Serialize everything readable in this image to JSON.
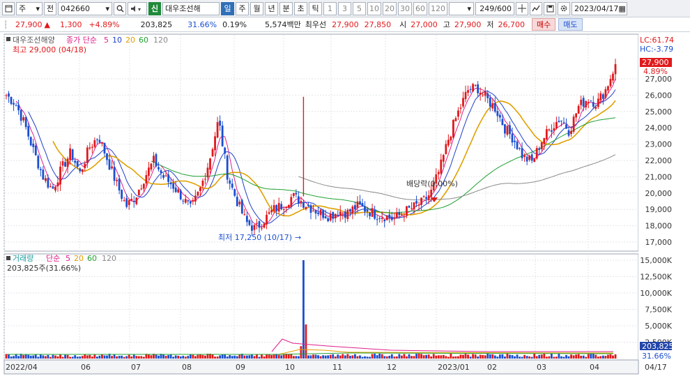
{
  "toolbar": {
    "market_select": "주",
    "prev_label": "전",
    "code_value": "042660",
    "stock_name": "대우조선해",
    "new_badge": "신",
    "period_tabs": [
      "일",
      "주",
      "월",
      "년",
      "분",
      "초",
      "틱"
    ],
    "active_period": "일",
    "interval_tabs": [
      "1",
      "3",
      "5",
      "10",
      "20",
      "30",
      "60",
      "120"
    ],
    "count_value": "249/600",
    "date_value": "2023/04/17"
  },
  "quote": {
    "price": "27,900",
    "change_arrow": "▲",
    "change": "1,300",
    "change_pct": "+4.89%",
    "volume": "203,825",
    "volume_ratio": "31.66%",
    "turnover": "0.19%",
    "amount": "5,574백만",
    "best_ask_label": "최우선",
    "best_ask": "27,900",
    "best_bid": "27,850",
    "open_label": "시",
    "open": "27,000",
    "high_label": "고",
    "high": "27,900",
    "low_label": "저",
    "low": "26,700",
    "buy_label": "매수",
    "sell_label": "매도"
  },
  "price_pane": {
    "stock_label": "대우조선해양",
    "legend_prefix": "종가 단순",
    "ma_labels": [
      "5",
      "10",
      "20",
      "60",
      "120"
    ],
    "ma_colors": [
      "#e0208a",
      "#2040c8",
      "#e0a000",
      "#20a030",
      "#8a8a8a"
    ],
    "high_annotation": "최고 29,000 (04/18)",
    "low_annotation": "최저 17,250 (10/17)",
    "dividend_annotation": "배당락(0.00%)",
    "lc": "LC:61.74",
    "hc": "HC:-3.79",
    "current_price_tag": "27,900",
    "current_pct_tag": "4.89%",
    "y_ticks": [
      "27,000",
      "26,000",
      "25,000",
      "24,000",
      "23,000",
      "22,000",
      "21,000",
      "20,000",
      "19,000",
      "18,000",
      "17,000"
    ]
  },
  "volume_pane": {
    "legend_label": "거래량",
    "legend_prefix": "단순",
    "ma_labels": [
      "5",
      "20",
      "60",
      "120"
    ],
    "current_volume_text": "203,825주(31.66%)",
    "volume_tag": "203,825",
    "volume_pct_tag": "31.66%",
    "y_ticks": [
      "15,000K",
      "12,500K",
      "10,000K",
      "7,500K",
      "5,000K",
      "2,500K"
    ]
  },
  "x_axis": {
    "labels": [
      "2022/04",
      "06",
      "07",
      "08",
      "09",
      "10",
      "11",
      "12",
      "2023/01",
      "02",
      "03",
      "04"
    ],
    "right_label": "04/17"
  },
  "colors": {
    "up": "#e0191c",
    "down": "#1a4fd0",
    "toolbar_bg": "#eef0f4",
    "active_tab": "#2f6fb7"
  },
  "chart_data": {
    "type": "candlestick",
    "title": "대우조선해양",
    "y_range": [
      16500,
      29500
    ],
    "x_months": [
      "2022/04",
      "06",
      "07",
      "08",
      "09",
      "10",
      "11",
      "12",
      "2023/01",
      "02",
      "03",
      "04"
    ],
    "close_path_approx": [
      26000,
      25500,
      24200,
      22500,
      21000,
      20200,
      21500,
      22500,
      21200,
      22800,
      23500,
      22000,
      20500,
      19200,
      19800,
      21000,
      22000,
      21000,
      20500,
      19800,
      19000,
      20200,
      22000,
      24500,
      21000,
      19500,
      18200,
      17800,
      18400,
      19000,
      19300,
      19800,
      19500,
      19100,
      18800,
      18600,
      18900,
      18800,
      19200,
      19000,
      18700,
      18600,
      18400,
      18800,
      19100,
      19400,
      20000,
      21500,
      23500,
      25000,
      26300,
      26500,
      25800,
      25200,
      24000,
      23300,
      22200,
      21900,
      23200,
      24000,
      24600,
      23800,
      25300,
      25800,
      25500,
      26400,
      27900
    ],
    "highest": {
      "label": "최고",
      "value": 29000,
      "date": "04/18"
    },
    "lowest": {
      "label": "최저",
      "value": 17250,
      "date": "10/17"
    },
    "volume_peak_k": 15000,
    "volume_range_k": [
      0,
      15500
    ]
  }
}
